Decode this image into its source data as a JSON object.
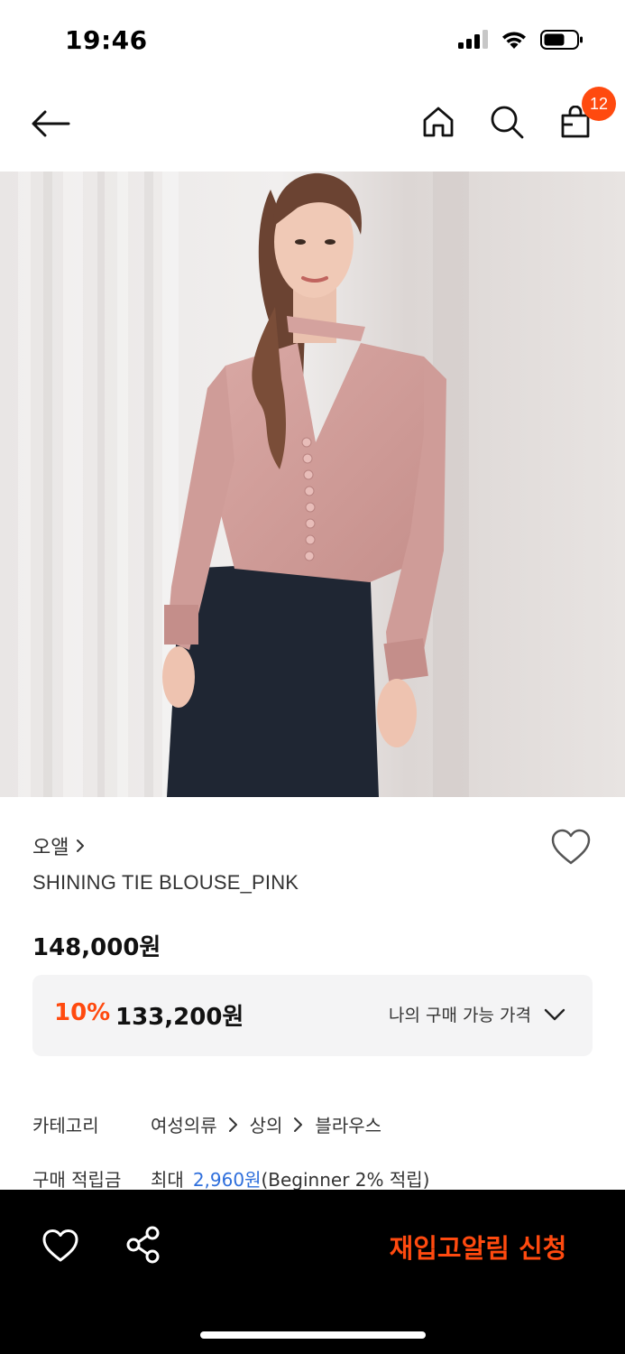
{
  "status_bar": {
    "time": "19:46"
  },
  "nav": {
    "cart_count": "12"
  },
  "product": {
    "brand": "오앨",
    "name": "SHINING TIE BLOUSE_PINK",
    "price_original": "148,000원",
    "discount_rate": "10%",
    "discount_price": "133,200원",
    "my_price_label": "나의 구매 가능 가격"
  },
  "details": {
    "category_label": "카테고리",
    "category_path": [
      "여성의류",
      "상의",
      "블라우스"
    ],
    "points_label": "구매 적립금",
    "points_prefix": "최대",
    "points_amount": "2,960원",
    "points_suffix": "(Beginner 2% 적립)"
  },
  "bottom_bar": {
    "restock_label": "재입고알림 신청"
  },
  "colors": {
    "accent": "#ff4a0f",
    "link": "#2f6fdc",
    "bar": "#000000"
  },
  "icons": [
    "back-arrow-icon",
    "home-icon",
    "search-icon",
    "cart-icon",
    "heart-icon",
    "share-icon",
    "chevron-down-icon",
    "chevron-right-icon"
  ]
}
